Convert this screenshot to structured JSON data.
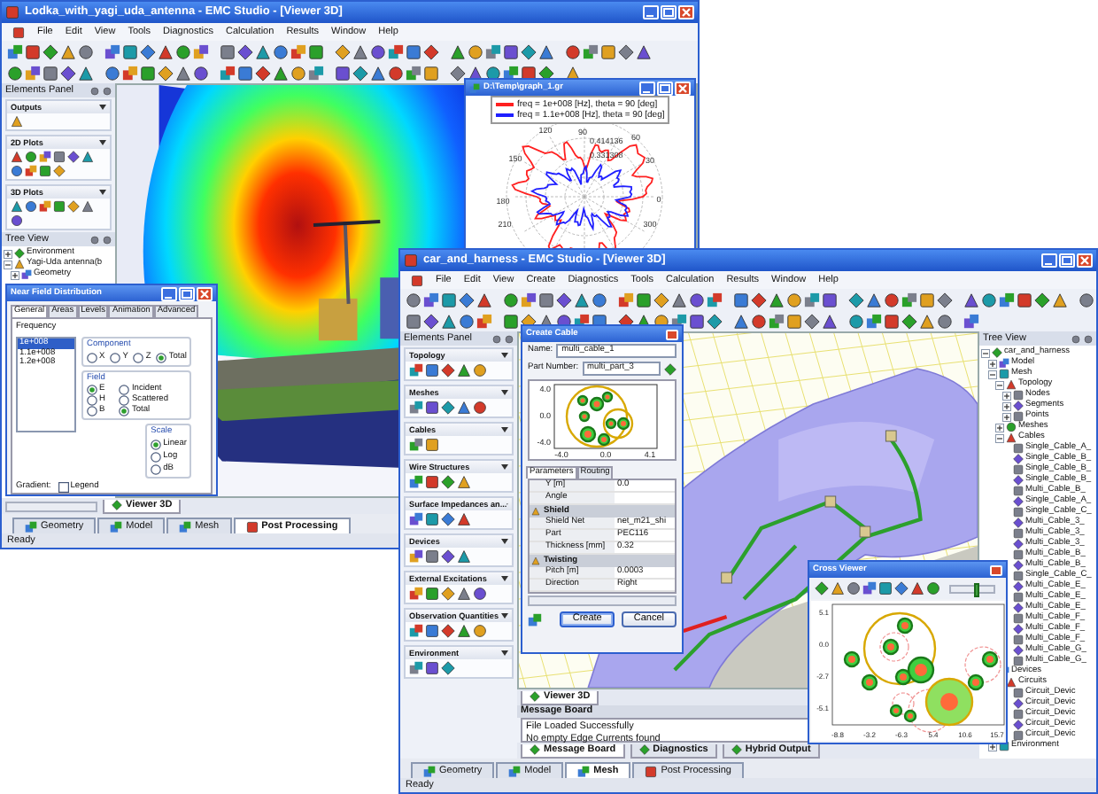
{
  "back_window": {
    "title": "Lodka_with_yagi_uda_antenna - EMC Studio - [Viewer 3D]",
    "menu": [
      "File",
      "Edit",
      "View",
      "Tools",
      "Diagnostics",
      "Calculation",
      "Results",
      "Window",
      "Help"
    ],
    "elements_panel": {
      "title": "Elements Panel",
      "sections": [
        "Outputs",
        "2D Plots",
        "3D Plots"
      ]
    },
    "tree_view": {
      "title": "Tree View",
      "items": [
        {
          "label": "Environment",
          "expanded": false
        },
        {
          "label": "Yagi-Uda antenna(b",
          "expanded": true,
          "children": [
            {
              "label": "Geometry",
              "expanded": false
            }
          ]
        }
      ]
    },
    "graph_window": {
      "title": "D:\\Temp\\graph_1.gr",
      "legend": [
        {
          "label": "freq = 1e+008 [Hz], theta = 90 [deg]",
          "color": "#ff2020"
        },
        {
          "label": "freq = 1.1e+008 [Hz], theta = 90 [deg]",
          "color": "#2020ff"
        }
      ],
      "radial_labels": [
        "0.414136",
        "0.331308"
      ],
      "angle_labels": [
        "90",
        "60",
        "30",
        "0",
        "120",
        "150",
        "180",
        "210",
        "300"
      ]
    },
    "near_field": {
      "title": "Near Field Distribution",
      "tabs": [
        {
          "label": "General",
          "selected": true
        },
        {
          "label": "Areas",
          "selected": false
        },
        {
          "label": "Levels",
          "selected": false
        },
        {
          "label": "Animation",
          "selected": false
        },
        {
          "label": "Advanced",
          "selected": false
        }
      ],
      "frequency_label": "Frequency",
      "frequencies": [
        {
          "label": "1e+008",
          "selected": true
        },
        {
          "label": "1.1e+008",
          "selected": false
        },
        {
          "label": "1.2e+008",
          "selected": false
        }
      ],
      "component": {
        "label": "Component",
        "options": [
          {
            "label": "X",
            "selected": false
          },
          {
            "label": "Y",
            "selected": false
          },
          {
            "label": "Z",
            "selected": false
          },
          {
            "label": "Total",
            "selected": true
          }
        ]
      },
      "field": {
        "label": "Field",
        "options": [
          {
            "label": "E",
            "selected": true
          },
          {
            "label": "H",
            "selected": false
          },
          {
            "label": "B",
            "selected": false
          }
        ],
        "source_options": [
          {
            "label": "Incident",
            "selected": false
          },
          {
            "label": "Scattered",
            "selected": false
          },
          {
            "label": "Total",
            "selected": true
          }
        ]
      },
      "scale": {
        "label": "Scale",
        "options": [
          {
            "label": "Linear",
            "selected": true
          },
          {
            "label": "Log",
            "selected": false
          },
          {
            "label": "dB",
            "selected": false
          }
        ]
      },
      "gradient_label": "Gradient:",
      "legend": {
        "label": "Legend",
        "checked": false
      }
    },
    "view_tabs": [
      {
        "label": "Viewer 3D",
        "selected": true
      }
    ],
    "mode_tabs": [
      {
        "label": "Geometry",
        "selected": false
      },
      {
        "label": "Model",
        "selected": false
      },
      {
        "label": "Mesh",
        "selected": false
      },
      {
        "label": "Post Processing",
        "selected": true
      }
    ],
    "status": "Ready"
  },
  "front_window": {
    "title": "car_and_harness - EMC Studio - [Viewer 3D]",
    "menu": [
      "File",
      "Edit",
      "View",
      "Create",
      "Diagnostics",
      "Tools",
      "Calculation",
      "Results",
      "Window",
      "Help"
    ],
    "elements_panel": {
      "title": "Elements Panel",
      "sections": [
        "Topology",
        "Meshes",
        "Cables",
        "Wire Structures",
        "Surface Impedances an...",
        "Devices",
        "External Excitations",
        "Observation Quantities",
        "Environment"
      ]
    },
    "create_cable": {
      "title": "Create Cable",
      "fields": [
        {
          "label": "Name:",
          "value": "multi_cable_1"
        },
        {
          "label": "Part Number:",
          "value": "multi_part_3"
        }
      ],
      "y_labels": [
        "4.0",
        "0.0",
        "-4.0"
      ],
      "x_labels": [
        "-4.0",
        "0.0",
        "4.1"
      ],
      "tabs": [
        {
          "label": "Parameters",
          "selected": true
        },
        {
          "label": "Routing",
          "selected": false
        }
      ],
      "properties": [
        {
          "kind": "property",
          "label": "Y [m]",
          "value": "0.0"
        },
        {
          "kind": "property",
          "label": "Angle"
        },
        {
          "kind": "category",
          "label": "Shield"
        },
        {
          "kind": "property",
          "label": "Shield Net",
          "value": "net_m21_shi"
        },
        {
          "kind": "property",
          "label": "Part",
          "value": "PEC116"
        },
        {
          "kind": "property",
          "label": "Thickness [mm]",
          "value": "0.32"
        },
        {
          "kind": "category",
          "label": "Twisting"
        },
        {
          "kind": "property",
          "label": "Pitch [m]",
          "value": "0.0003"
        },
        {
          "kind": "property",
          "label": "Direction",
          "value": "Right"
        }
      ],
      "buttons": [
        {
          "label": "Create",
          "default": true
        },
        {
          "label": "Cancel",
          "default": false
        }
      ]
    },
    "view_tabs": [
      {
        "label": "Viewer 3D",
        "selected": true
      }
    ],
    "message_board": {
      "title": "Message Board",
      "messages": [
        "File Loaded Successfully",
        "No empty Edge Currents found"
      ]
    },
    "board_tabs": [
      {
        "label": "Message Board",
        "selected": true
      },
      {
        "label": "Diagnostics",
        "selected": false
      },
      {
        "label": "Hybrid Output",
        "selected": false
      }
    ],
    "tree_view": {
      "title": "Tree View",
      "items": [
        {
          "label": "car_and_harness",
          "expanded": true,
          "children": [
            {
              "label": "Model",
              "expanded": false
            },
            {
              "label": "Mesh",
              "expanded": true,
              "children": [
                {
                  "label": "Topology",
                  "expanded": true,
                  "children": [
                    {
                      "label": "Nodes",
                      "expanded": false
                    },
                    {
                      "label": "Segments",
                      "expanded": false
                    },
                    {
                      "label": "Points",
                      "expanded": false
                    }
                  ]
                },
                {
                  "label": "Meshes",
                  "expanded": false
                },
                {
                  "label": "Cables",
                  "expanded": true,
                  "children": [
                    {
                      "label": "Single_Cable_A_"
                    },
                    {
                      "label": "Single_Cable_B_"
                    },
                    {
                      "label": "Single_Cable_B_"
                    },
                    {
                      "label": "Single_Cable_B_"
                    },
                    {
                      "label": "Multi_Cable_B_"
                    },
                    {
                      "label": "Single_Cable_A_"
                    },
                    {
                      "label": "Single_Cable_C_"
                    },
                    {
                      "label": "Multi_Cable_3_"
                    },
                    {
                      "label": "Multi_Cable_3_"
                    },
                    {
                      "label": "Multi_Cable_3_"
                    },
                    {
                      "label": "Multi_Cable_B_"
                    },
                    {
                      "label": "Multi_Cable_B_"
                    },
                    {
                      "label": "Single_Cable_C_"
                    },
                    {
                      "label": "Multi_Cable_E_"
                    },
                    {
                      "label": "Multi_Cable_E_"
                    },
                    {
                      "label": "Multi_Cable_E_"
                    },
                    {
                      "label": "Multi_Cable_F_"
                    },
                    {
                      "label": "Multi_Cable_F_"
                    },
                    {
                      "label": "Multi_Cable_F_"
                    },
                    {
                      "label": "Multi_Cable_G_"
                    },
                    {
                      "label": "Multi_Cable_G_"
                    }
                  ]
                }
              ]
            },
            {
              "label": "Devices",
              "expanded": true,
              "children": [
                {
                  "label": "Circuits",
                  "expanded": true,
                  "children": [
                    {
                      "label": "Circuit_Devic"
                    },
                    {
                      "label": "Circuit_Devic"
                    },
                    {
                      "label": "Circuit_Devic"
                    },
                    {
                      "label": "Circuit_Devic"
                    },
                    {
                      "label": "Circuit_Devic"
                    }
                  ]
                }
              ]
            },
            {
              "label": "Environment",
              "expanded": false
            }
          ]
        }
      ]
    },
    "cross_viewer": {
      "title": "Cross Viewer",
      "zoom_slider": {
        "level": 0.55
      },
      "y_labels": [
        "5.1",
        "0.0",
        "-2.7",
        "-5.1"
      ],
      "x_labels": [
        "-8.8",
        "-3.2",
        "-6.3",
        "5.4",
        "10.6",
        "15.7"
      ]
    },
    "mode_tabs": [
      {
        "label": "Geometry",
        "selected": false
      },
      {
        "label": "Model",
        "selected": false
      },
      {
        "label": "Mesh",
        "selected": true
      },
      {
        "label": "Post Processing",
        "selected": false
      }
    ],
    "status": "Ready"
  }
}
